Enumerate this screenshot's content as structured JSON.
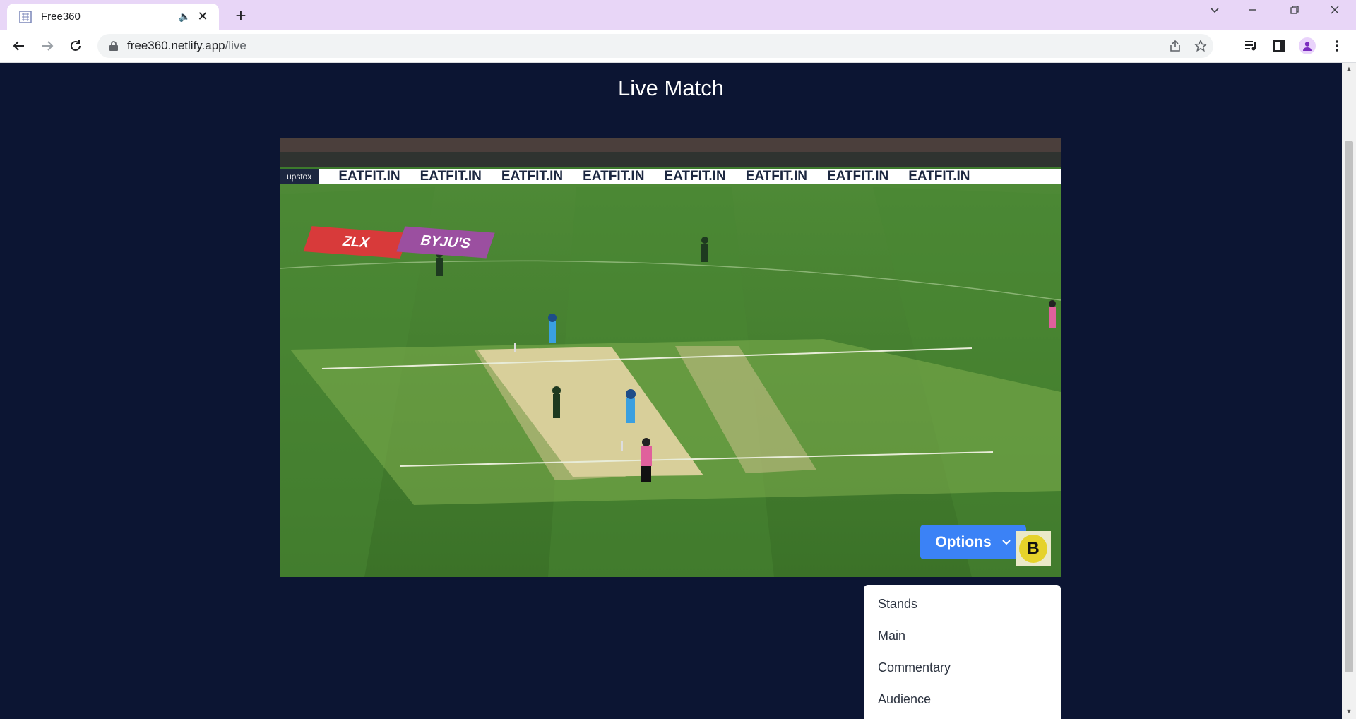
{
  "browser": {
    "tab_title": "Free360",
    "url_host": "free360.netlify.app",
    "url_path": "/live",
    "new_tab_symbol": "+",
    "tab_close_symbol": "✕",
    "tab_audio_symbol": "🔈"
  },
  "page": {
    "title": "Live Match"
  },
  "video": {
    "ad_board_text": "EATFIT.IN",
    "side_sponsor_left": "upstox",
    "ground_ad_1": "ZLX",
    "ground_ad_2": "BYJU'S",
    "logo_letter": "B"
  },
  "options": {
    "label": "Options",
    "menu_items": [
      "Stands",
      "Main",
      "Commentary",
      "Audience"
    ]
  },
  "colors": {
    "tabbar": "#e8d6f7",
    "page_bg": "#0c1533",
    "options_button": "#3b82f6",
    "pitch_green": "#3d7a2c"
  }
}
